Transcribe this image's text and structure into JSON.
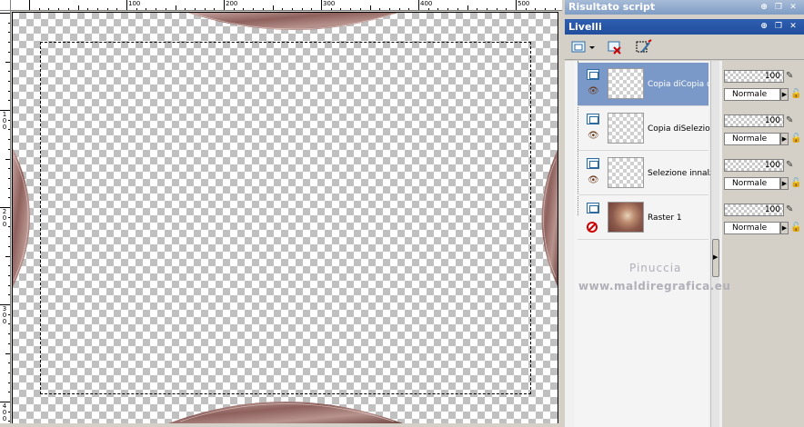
{
  "ruler": {
    "top_labels": [
      "100",
      "200",
      "300",
      "400",
      "500"
    ],
    "left_labels": [
      "100",
      "200",
      "300",
      "400"
    ]
  },
  "panels": {
    "script_title": "Risultato script",
    "layers_title": "Livelli"
  },
  "layers": [
    {
      "name": "Copia diCopia diSe",
      "opacity": "100",
      "blend": "Normale",
      "selected": true,
      "visible": true
    },
    {
      "name": "Copia diSelezione i",
      "opacity": "100",
      "blend": "Normale",
      "selected": false,
      "visible": true
    },
    {
      "name": "Selezione innalzata",
      "opacity": "100",
      "blend": "Normale",
      "selected": false,
      "visible": true
    },
    {
      "name": "Raster 1",
      "opacity": "100",
      "blend": "Normale",
      "selected": false,
      "visible": false
    }
  ],
  "watermark": {
    "line1": "Pinuccia",
    "line2": "www.maldiregrafica.eu"
  },
  "colors": {
    "selected_row": "#7a99c8",
    "panel_title_active": "#2e5fb0",
    "panel_title_inactive": "#7f9cc4",
    "ornament": "#a77e7a"
  }
}
